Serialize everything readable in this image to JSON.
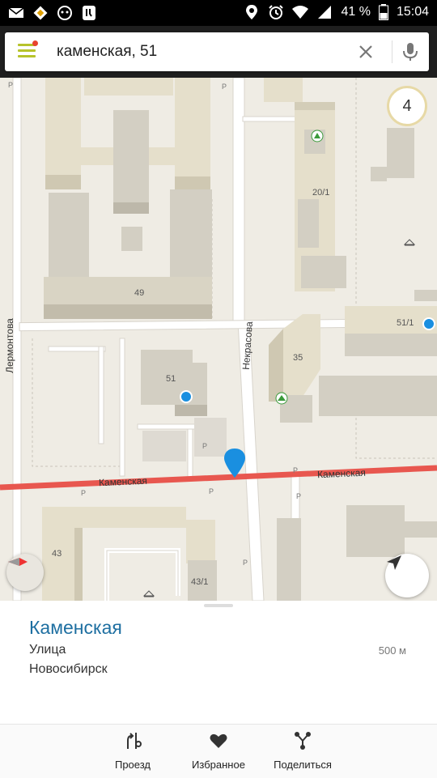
{
  "status_bar": {
    "battery": "41 %",
    "time": "15:04"
  },
  "search": {
    "value": "каменская, 51"
  },
  "map": {
    "zoom_level": "4",
    "streets": {
      "lermontova": "Лермонтова",
      "nekrasova": "Некрасова",
      "kamenskaya_1": "Каменская",
      "kamenskaya_2": "Каменская"
    },
    "house_numbers": {
      "h49": "49",
      "h20_1": "20/1",
      "h51_1": "51/1",
      "h35": "35",
      "h51": "51",
      "h43": "43",
      "h43_1": "43/1"
    },
    "parking_mark": "P"
  },
  "place_card": {
    "title": "Каменская",
    "type": "Улица",
    "city": "Новосибирск",
    "distance": "500 м"
  },
  "actions": {
    "route_label": "Проезд",
    "favorites_label": "Избранное",
    "share_label": "Поделиться"
  },
  "colors": {
    "accent_blue": "#1e6fa1",
    "route_red": "#e8574f",
    "menu_green": "#b7c32b",
    "pin_blue": "#1a8fe0"
  }
}
